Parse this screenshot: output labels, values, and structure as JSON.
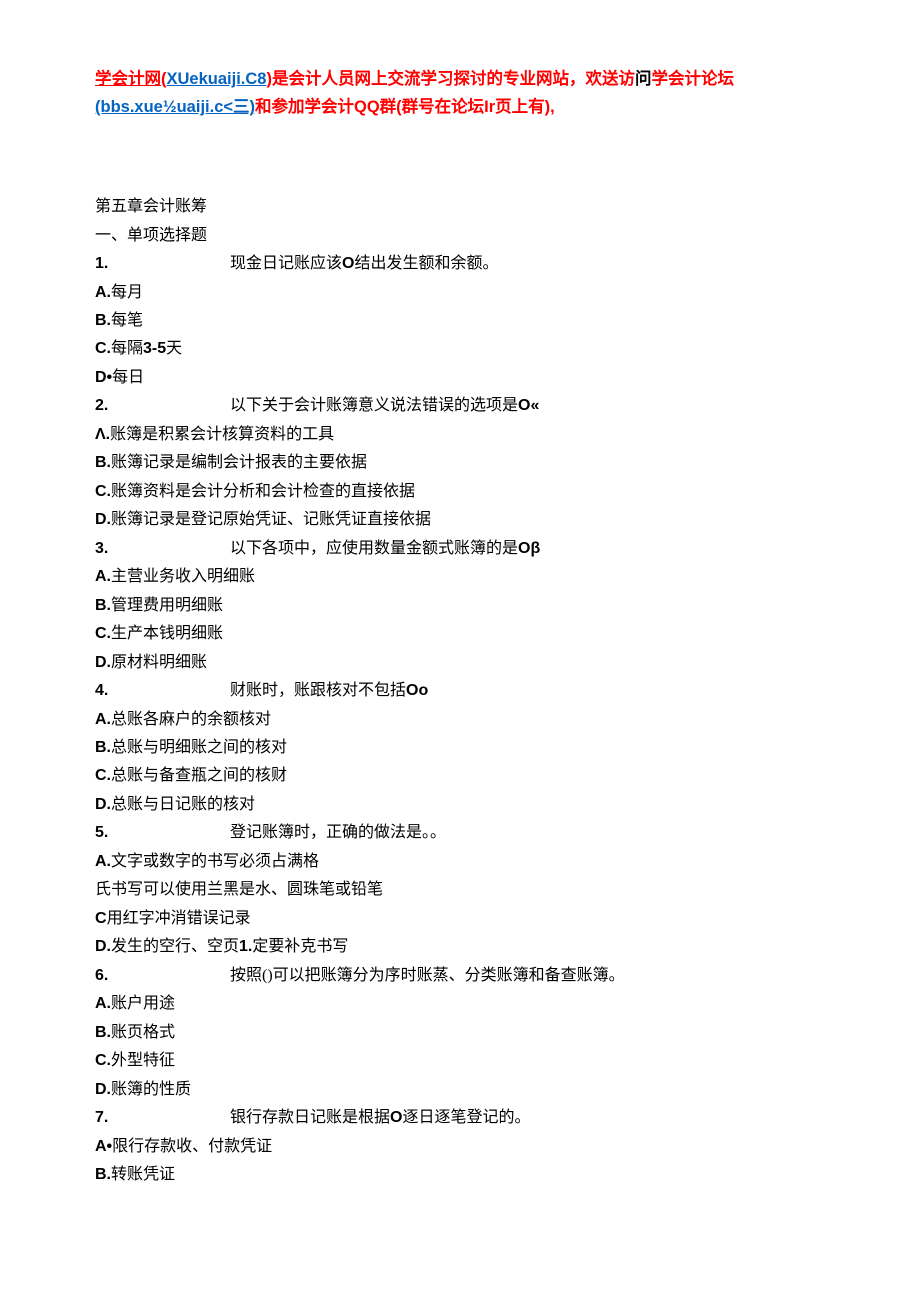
{
  "header": {
    "part1": "学会计网",
    "part2": "(",
    "part3": "XUekuaiji.C8",
    "part4": ")",
    "part5": "是会计人员网上交流学习探讨的专业网站，欢送访",
    "part6": "问",
    "part7": "学会计论坛",
    "part8": "(bbs.xue½uaiji.c<三)",
    "part9": "和参加学会计QQ群(群号在论坛Ir页上有),"
  },
  "content": {
    "chapter": "第五章会计账筹",
    "section": "一、单项选择题",
    "q1": {
      "num": "1.",
      "text": "现金日记账应该",
      "marker": "O",
      "text2": "结出发生额和余额。",
      "a": "每月",
      "b": "每笔",
      "c": "每隔",
      "c_num": "3-5",
      "c_suffix": "天",
      "d": "每日"
    },
    "q2": {
      "num": "2.",
      "text": "以下关于会计账簿意义说法错误的选项是",
      "marker": "O«",
      "a_prefix": "Λ.",
      "a": "账簿是积累会计核算资料的工具",
      "b": "账簿记录是编制会计报表的主要依据",
      "c": "账簿资料是会计分析和会计检查的直接依据",
      "d": "账簿记录是登记原始凭证、记账凭证直接依据"
    },
    "q3": {
      "num": "3.",
      "text": "以下各项中，应使用数量金额式账簿的是",
      "marker": "Oβ",
      "a": "主营业务收入明细账",
      "b": "管理费用明细账",
      "c": "生产本钱明细账",
      "d": "原材料明细账"
    },
    "q4": {
      "num": "4.",
      "text": "财账时，账跟核对不包括",
      "marker": "Oo",
      "a": "总账各麻户的余额核对",
      "b": "总账与明细账之间的核对",
      "c": "总账与备查瓶之间的核财",
      "d": "总账与日记账的核对"
    },
    "q5": {
      "num": "5.",
      "text": "登记账簿时，正确的做法是。。",
      "a": "文字或数字的书写必须占满格",
      "b_text": "氏书写可以使用兰黑是水、圆珠笔或铅笔",
      "c_prefix": "C",
      "c": "用红字冲消错误记录",
      "d_prefix": "D.",
      "d_text1": "发生的空行、空页",
      "d_num": "1.",
      "d_text2": "定要补克书写"
    },
    "q6": {
      "num": "6.",
      "text": "按照()可以把账簿分为序时账蒸、分类账簿和备查账簿。",
      "a": "账户用途",
      "b": "账页格式",
      "c": "外型特征",
      "d": "账簿的性质"
    },
    "q7": {
      "num": "7.",
      "text": "银行存款日记账是根据",
      "marker": "O",
      "text2": "逐日逐笔登记的。",
      "a_prefix": "A•",
      "a": "限行存款收、付款凭证",
      "b": "转账凭证"
    }
  }
}
